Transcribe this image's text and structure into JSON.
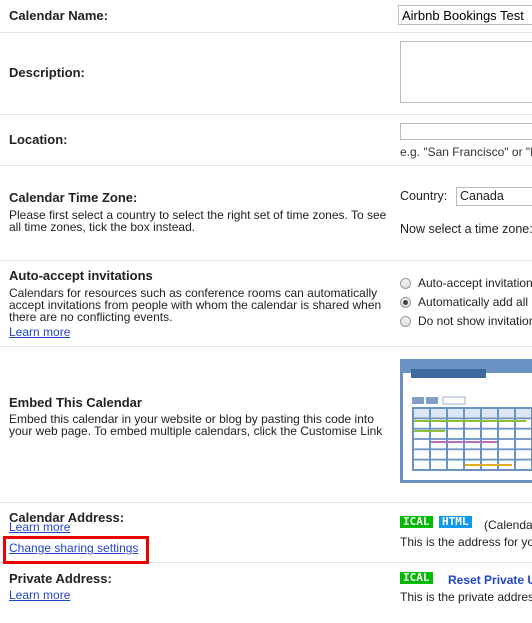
{
  "calendar_name": {
    "label": "Calendar Name:",
    "value": "Airbnb Bookings Test"
  },
  "description": {
    "label": "Description:",
    "value": ""
  },
  "location": {
    "label": "Location:",
    "value": "",
    "hint": "e.g. \"San Francisco\" or \"N"
  },
  "time_zone": {
    "label": "Calendar Time Zone:",
    "desc": "Please first select a country to select the right set of time zones. To see all time zones, tick the box instead.",
    "country_label": "Country:",
    "country_value": "Canada",
    "tz_label": "Now select a time zone:"
  },
  "auto_accept": {
    "label": "Auto-accept invitations",
    "desc": "Calendars for resources such as conference rooms can automatically accept invitations from people with whom the calendar is shared when there are no conflicting events.",
    "learn_more": "Learn more",
    "options": [
      {
        "label": "Auto-accept invitation",
        "selected": false
      },
      {
        "label": "Automatically add all",
        "selected": true
      },
      {
        "label": "Do not show invitation",
        "selected": false
      }
    ]
  },
  "embed": {
    "label": "Embed This Calendar",
    "desc": "Embed this calendar in your website or blog by pasting this code into your web page. To embed multiple calendars, click the Customise Link",
    "preview_icon": "calendar-preview-image"
  },
  "calendar_address": {
    "label": "Calendar Address:",
    "learn_more": "Learn more",
    "change_sharing": "Change sharing settings",
    "ical": "ICAL",
    "html": "HTML",
    "note": "(Calendar",
    "desc": "This is the address for your"
  },
  "private_address": {
    "label": "Private Address:",
    "learn_more": "Learn more",
    "ical": "ICAL",
    "reset": "Reset Private U",
    "desc": "This is the private address"
  },
  "colors": {
    "ical": "#00bb00",
    "html": "#1199ee",
    "highlight": "#ee0000",
    "link": "#2244cc"
  }
}
